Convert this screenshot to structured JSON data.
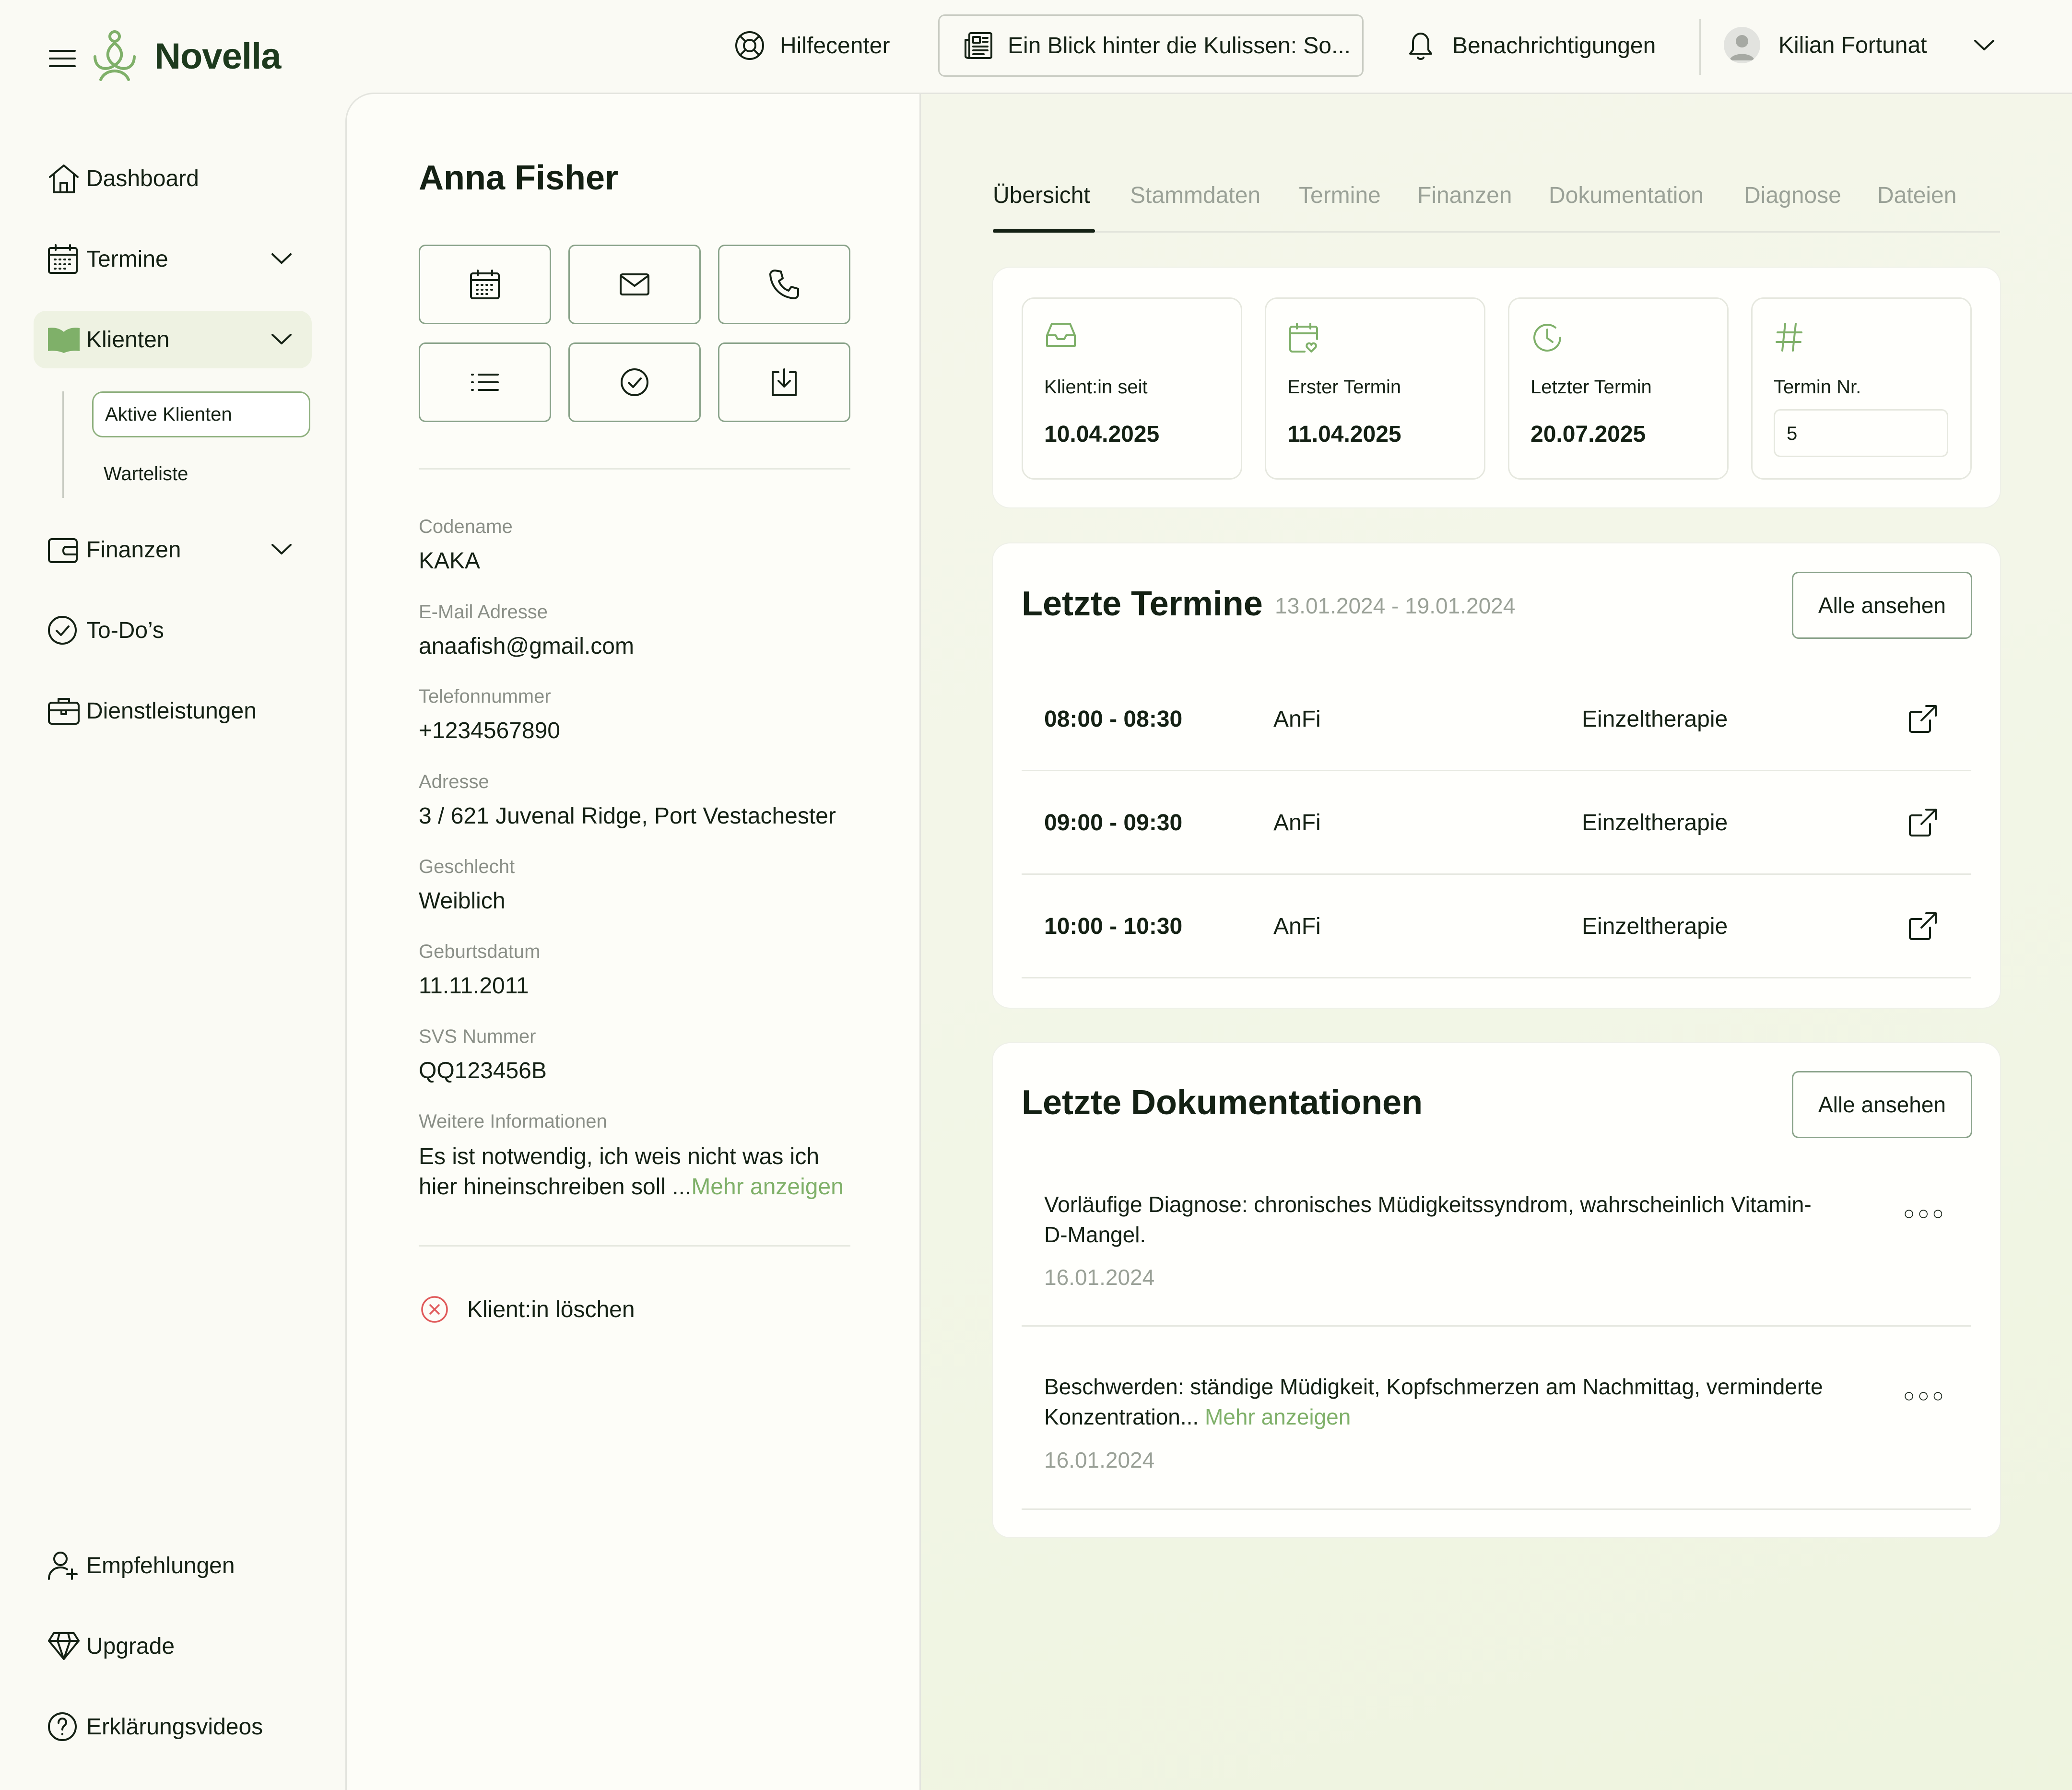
{
  "app": {
    "brand": "Novella"
  },
  "topbar": {
    "help_label": "Hilfecenter",
    "news_label": "Ein Blick hinter die Kulissen: So...",
    "notifications_label": "Benachrichtigungen",
    "user_name": "Kilian Fortunat"
  },
  "sidebar": {
    "dashboard": "Dashboard",
    "termine": "Termine",
    "klienten": "Klienten",
    "aktive_klienten": "Aktive Klienten",
    "warteliste": "Warteliste",
    "finanzen": "Finanzen",
    "todos": "To-Do’s",
    "dienstleistungen": "Dienstleistungen",
    "empfehlungen": "Empfehlungen",
    "upgrade": "Upgrade",
    "erklaerungsvideos": "Erklärungsvideos"
  },
  "client": {
    "name": "Anna Fisher",
    "fields": {
      "codename_label": "Codename",
      "codename": "KAKA",
      "email_label": "E-Mail Adresse",
      "email": "anaafish@gmail.com",
      "phone_label": "Telefonnummer",
      "phone": "+1234567890",
      "address_label": "Adresse",
      "address": "3 / 621 Juvenal Ridge, Port Vestachester",
      "gender_label": "Geschlecht",
      "gender": "Weiblich",
      "birth_label": "Geburtsdatum",
      "birth": "11.11.2011",
      "svs_label": "SVS Nummer",
      "svs": "QQ123456B",
      "info_label": "Weitere Informationen",
      "info_line1": "Es ist notwendig, ich weis nicht was ich",
      "info_line2": "hier hineinschreiben soll ...",
      "info_more": "Mehr anzeigen"
    },
    "delete_label": "Klient:in löschen"
  },
  "tabs": [
    "Übersicht",
    "Stammdaten",
    "Termine",
    "Finanzen",
    "Dokumentation",
    "Diagnose",
    "Dateien"
  ],
  "stats": {
    "since_label": "Klient:in seit",
    "since": "10.04.2025",
    "first_label": "Erster Termin",
    "first": "11.04.2025",
    "last_label": "Letzter Termin",
    "last": "20.07.2025",
    "nr_label": "Termin Nr.",
    "nr": "5"
  },
  "appointments": {
    "title": "Letzte Termine",
    "range": "13.01.2024 - 19.01.2024",
    "view_all": "Alle ansehen",
    "rows": [
      {
        "time": "08:00 - 08:30",
        "who": "AnFi",
        "type": "Einzeltherapie"
      },
      {
        "time": "09:00 - 09:30",
        "who": "AnFi",
        "type": "Einzeltherapie"
      },
      {
        "time": "10:00 - 10:30",
        "who": "AnFi",
        "type": "Einzeltherapie"
      }
    ]
  },
  "docs": {
    "title": "Letzte Dokumentationen",
    "view_all": "Alle ansehen",
    "items": [
      {
        "line1": "Vorläufige Diagnose: chronisches Müdigkeitssyndrom, wahrscheinlich Vitamin-",
        "line2": "D-Mangel.",
        "more": "",
        "date": "16.01.2024"
      },
      {
        "line1": "Beschwerden: ständige Müdigkeit, Kopfschmerzen am Nachmittag, verminderte",
        "line2": "Konzentration...",
        "more": "Mehr anzeigen",
        "date": "16.01.2024"
      }
    ]
  },
  "colors": {
    "accent": "#7fb069",
    "ink": "#142114",
    "danger": "#e05b5b"
  }
}
